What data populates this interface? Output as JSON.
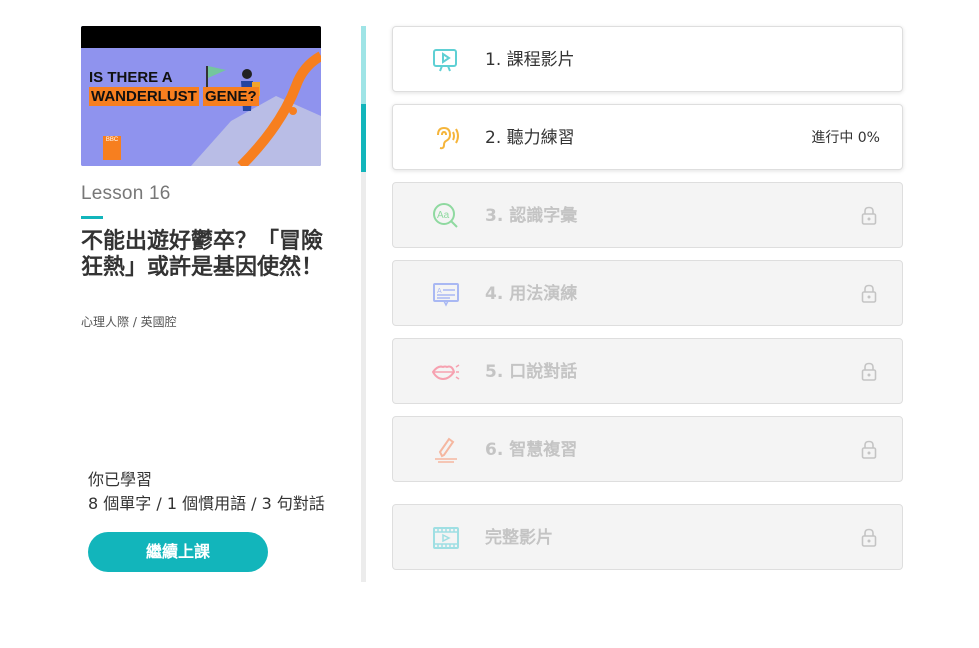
{
  "lesson": {
    "number_label": "Lesson 16",
    "title": "不能出遊好鬱卒？「冒險狂熱」或許是基因使然！",
    "tags": "心理人際 / 英國腔",
    "thumbnail": {
      "line1": "IS THERE A",
      "line2": "WANDERLUST",
      "line3": "GENE?",
      "badge": "BBC"
    }
  },
  "summary": {
    "label": "你已學習",
    "stats": "8 個單字 / 1 個慣用語 / 3 句對話"
  },
  "continue_button": "繼續上課",
  "steps": [
    {
      "label": "1. 課程影片",
      "icon": "video-lesson-icon",
      "state": "done"
    },
    {
      "label": "2. 聽力練習",
      "icon": "ear-icon",
      "state": "in-progress",
      "status": "進行中 0%"
    },
    {
      "label": "3. 認識字彙",
      "icon": "vocabulary-search-icon",
      "state": "locked"
    },
    {
      "label": "4. 用法演練",
      "icon": "usage-practice-icon",
      "state": "locked"
    },
    {
      "label": "5. 口說對話",
      "icon": "lips-speaking-icon",
      "state": "locked"
    },
    {
      "label": "6. 智慧複習",
      "icon": "pen-review-icon",
      "state": "locked"
    },
    {
      "label": "完整影片",
      "icon": "film-icon",
      "state": "locked"
    }
  ],
  "colors": {
    "accent": "#12b5bb",
    "accent_light": "#9fe4e6",
    "icon_video": "#5fd0d4",
    "icon_ear": "#f5b53b",
    "icon_vocab": "#8fd9a0",
    "icon_usage": "#a9b8f3",
    "icon_lips": "#f6a1b0",
    "icon_pen": "#f5b7a0",
    "icon_film": "#9fdfe3"
  }
}
